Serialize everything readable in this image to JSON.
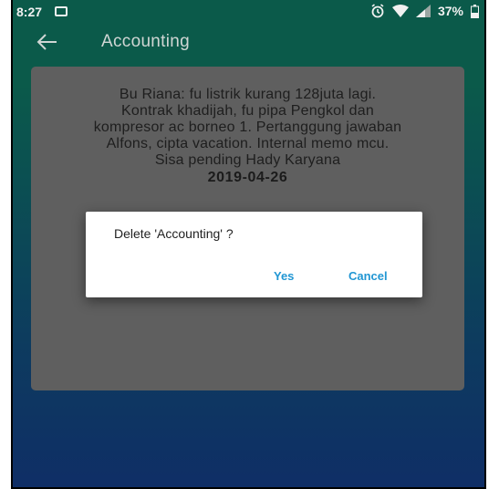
{
  "status_bar": {
    "time": "8:27",
    "battery": "37%",
    "icons": [
      "image-notification-icon",
      "alarm-icon",
      "wifi-icon",
      "signal-icon",
      "battery-icon"
    ]
  },
  "app_bar": {
    "title": "Accounting",
    "back_icon": "arrow-left-icon"
  },
  "note": {
    "lines": [
      "Bu Riana: fu listrik kurang 128juta lagi.",
      "Kontrak khadijah, fu pipa Pengkol dan",
      "kompresor ac borneo 1. Pertanggung jawaban",
      "Alfons, cipta vacation. Internal memo mcu.",
      "Sisa pending Hady Karyana"
    ],
    "date": "2019-04-26"
  },
  "dialog": {
    "message": "Delete 'Accounting' ?",
    "yes_label": "Yes",
    "cancel_label": "Cancel"
  },
  "colors": {
    "accent": "#2196d3",
    "appbar_bg": "#0b5a4a",
    "bottom_bg": "#0f2e66",
    "card_bg": "#5f5f5f"
  }
}
